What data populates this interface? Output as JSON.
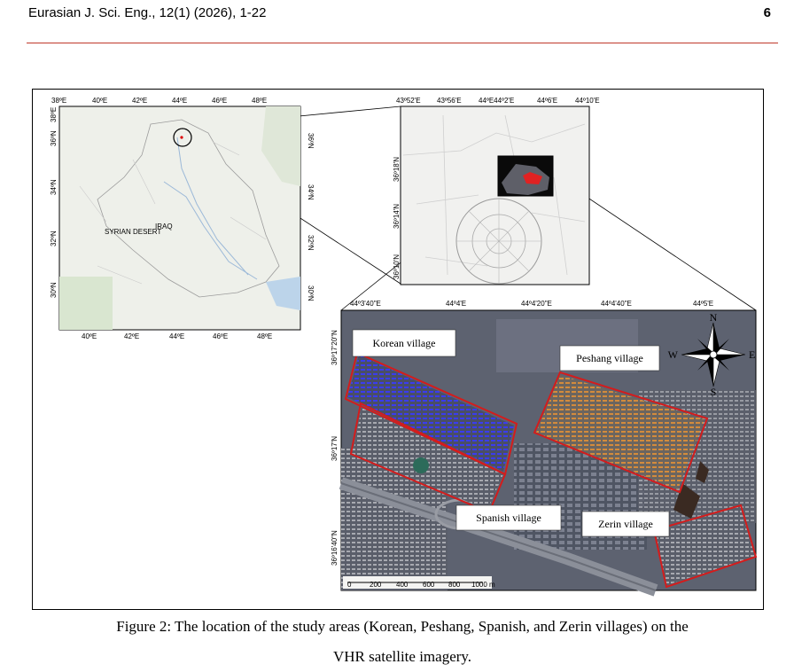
{
  "header": {
    "journal": "Eurasian J. Sci. Eng., 12(1) (2026), 1-22",
    "page_number": "6"
  },
  "figure": {
    "caption_line1": "Figure 2: The location of the study areas (Korean, Peshang, Spanish, and Zerin villages) on the",
    "caption_line2": "VHR satellite imagery.",
    "map1": {
      "top_ticks": [
        "38ºE",
        "40ºE",
        "42ºE",
        "44ºE",
        "46ºE",
        "48ºE"
      ],
      "bottom_ticks": [
        "40ºE",
        "42ºE",
        "44ºE",
        "46ºE",
        "48ºE"
      ],
      "left_ticks": [
        "38ºE",
        "36ºN",
        "34ºN",
        "32ºN",
        "30ºN"
      ],
      "right_ticks": [
        "36ºN",
        "34ºN",
        "32ºN",
        "30ºN"
      ],
      "place_labels": [
        "SYRIAN DESERT",
        "IRAQ"
      ]
    },
    "map2": {
      "top_ticks": [
        "43º52'E",
        "43º56'E",
        "44ºE44º2'E",
        "44º6'E",
        "44º10'E"
      ],
      "left_ticks": [
        "36º18'N",
        "36º14'N",
        "36º10'N"
      ]
    },
    "map3": {
      "top_ticks": [
        "44º3'40\"E",
        "44º4'E",
        "44º4'20\"E",
        "44º4'40\"E",
        "44º5'E"
      ],
      "left_ticks": [
        "36º17'20\"N",
        "36º17'N",
        "36º16'40\"N"
      ],
      "labels": {
        "korean": "Korean village",
        "peshang": "Peshang village",
        "spanish": "Spanish village",
        "zerin": "Zerin village"
      },
      "compass": {
        "n": "N",
        "s": "S",
        "e": "E",
        "w": "W"
      },
      "scale_ticks": [
        "0",
        "200",
        "400",
        "600",
        "800",
        "1000 m"
      ]
    }
  }
}
